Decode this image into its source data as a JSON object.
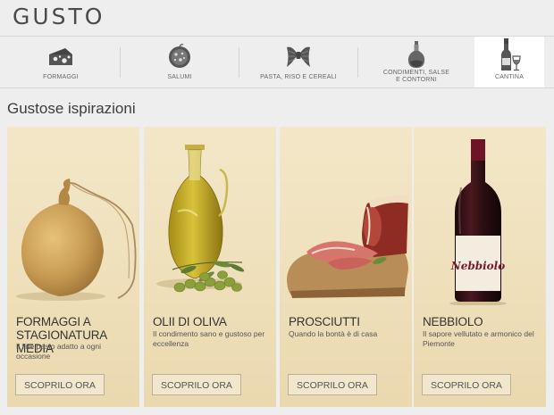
{
  "header": {
    "title": "GUSTO"
  },
  "categories": [
    {
      "label": "FORMAGGI",
      "icon": "cheese-icon"
    },
    {
      "label": "SALUMI",
      "icon": "salami-icon"
    },
    {
      "label": "PASTA, RISO E CEREALI",
      "icon": "pasta-icon"
    },
    {
      "label": "CONDIMENTI, SALSE E CONTORNI",
      "label_line1": "CONDIMENTI, SALSE",
      "label_line2": "E CONTORNI",
      "icon": "oil-bottle-icon"
    },
    {
      "label": "CANTINA",
      "icon": "wine-bottle-icon",
      "active": true
    }
  ],
  "section": {
    "title": "Gustose ispirazioni"
  },
  "cards": [
    {
      "title_line1": "FORMAGGI A",
      "title_line2": "STAGIONATURA MEDIA",
      "description": "Il fine pasto adatto a ogni occasione",
      "button": "SCOPRILO ORA",
      "image": "caciocavallo-cheese"
    },
    {
      "title_line1": "OLII DI OLIVA",
      "description": "Il condimento sano e gustoso per eccellenza",
      "button": "SCOPRILO ORA",
      "image": "olive-oil-bottle"
    },
    {
      "title_line1": "PROSCIUTTI",
      "description": "Quando la bontà è di casa",
      "button": "SCOPRILO ORA",
      "image": "prosciutto-board"
    },
    {
      "title_line1": "NEBBIOLO",
      "description": "Il sapore vellutato e armonico del Piemonte",
      "button": "SCOPRILO ORA",
      "image": "wine-bottle",
      "bottle_label": "Nebbiolo"
    }
  ],
  "colors": {
    "background": "#eeeeee",
    "card_bg": "#efe0bb",
    "text_dark": "#333333",
    "wine_red": "#6e1426"
  }
}
